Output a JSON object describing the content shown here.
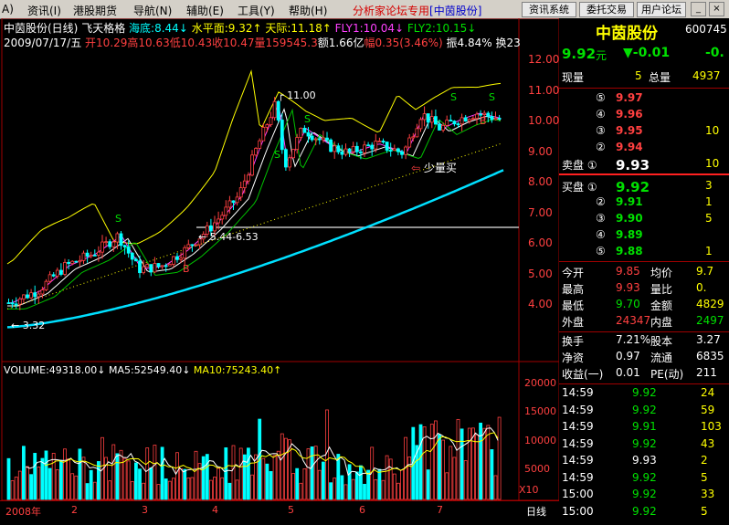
{
  "menu": {
    "items": [
      "A)",
      "资讯(I)",
      "港股期货",
      "导航(N)",
      "辅助(E)",
      "工具(Y)",
      "帮助(H)"
    ],
    "forum_title": "分析家论坛专用",
    "stock_tag": "[中茵股份]",
    "buttons": [
      "资讯系统",
      "委托交易",
      "用户论坛"
    ],
    "window_controls": [
      "_",
      "□",
      "×"
    ]
  },
  "chart_header": {
    "line1": {
      "name": "中茵股份(日线)",
      "indicator": "飞天格格",
      "haidi": "海底:8.44↓",
      "shuiping": "水平面:9.32↑",
      "tianji": "天际:11.18↑",
      "fly1": "FLY1:10.04↓",
      "fly2": "FLY2:10.15↓"
    },
    "line2": {
      "date": "2009/07/17/五",
      "open": "开10.29",
      "high": "高10.63",
      "low": "低10.43",
      "close": "收10.47",
      "volume": "量159545.3",
      "amount": "额1.66亿",
      "change": "幅0.35(3.46%)",
      "amplitude": "振4.84%",
      "turnover": "换23"
    }
  },
  "price_axis": [
    "12.00",
    "11.00",
    "10.00",
    "9.00",
    "8.00",
    "7.00",
    "6.00",
    "5.00",
    "4.00"
  ],
  "volume_axis": [
    "20000",
    "15000",
    "10000",
    "5000",
    "X10"
  ],
  "annotations": {
    "high_label": "11.00",
    "low_label": "3.32",
    "range_label": "5.44-6.53",
    "buy_text": "少量买",
    "s_marks": [
      "S",
      "S",
      "S",
      "S",
      "S"
    ],
    "b_marks": [
      "B",
      "B"
    ]
  },
  "volume_header": {
    "volume": "VOLUME:49318.00↓",
    "ma5": "MA5:52549.40↓",
    "ma10": "MA10:75243.40↑"
  },
  "date_axis": [
    "2008年",
    "2",
    "3",
    "4",
    "5",
    "6",
    "7"
  ],
  "period_label": "日线",
  "colors": {
    "up": "#ff4040",
    "down": "#00ffff",
    "ma_slow": "#00e0ff",
    "ma_yellow": "#ffff00",
    "ma_white": "#ffffff",
    "purple": "#ff40ff"
  },
  "quote": {
    "stock_name": "中茵股份",
    "code": "600745",
    "price": "9.92",
    "unit": "元",
    "change": "▼-0.01",
    "change_pct": "-0.",
    "xianliang_label": "现量",
    "xianliang_value": "5",
    "zongliang_label": "总量",
    "zongliang_value": "4937",
    "sell": [
      {
        "label": "⑤",
        "price": "9.97",
        "vol": ""
      },
      {
        "label": "④",
        "price": "9.96",
        "vol": ""
      },
      {
        "label": "③",
        "price": "9.95",
        "vol": "10"
      },
      {
        "label": "②",
        "price": "9.94",
        "vol": ""
      },
      {
        "label": "卖盘 ①",
        "price": "9.93",
        "vol": "10"
      }
    ],
    "buy": [
      {
        "label": "买盘 ①",
        "price": "9.92",
        "vol": "3"
      },
      {
        "label": "②",
        "price": "9.91",
        "vol": "1"
      },
      {
        "label": "③",
        "price": "9.90",
        "vol": "5"
      },
      {
        "label": "④",
        "price": "9.89",
        "vol": ""
      },
      {
        "label": "⑤",
        "price": "9.88",
        "vol": "1"
      }
    ],
    "stats": [
      {
        "l1": "今开",
        "v1": "9.85",
        "l2": "均价",
        "v2": "9.7"
      },
      {
        "l1": "最高",
        "v1": "9.93",
        "l2": "量比",
        "v2": "0."
      },
      {
        "l1": "最低",
        "v1": "9.70",
        "l2": "金额",
        "v2": "4829"
      },
      {
        "l1": "外盘",
        "v1": "24347",
        "l2": "内盘",
        "v2": "2497"
      }
    ],
    "fund": [
      {
        "l1": "换手",
        "v1": "7.21%",
        "l2": "股本",
        "v2": "3.27"
      },
      {
        "l1": "净资",
        "v1": "0.97",
        "l2": "流通",
        "v2": "6835"
      },
      {
        "l1": "收益(一)",
        "v1": "0.01",
        "l2": "PE(动)",
        "v2": "211"
      }
    ],
    "ticks": [
      {
        "time": "14:59",
        "price": "9.92",
        "vol": "24"
      },
      {
        "time": "14:59",
        "price": "9.92",
        "vol": "59"
      },
      {
        "time": "14:59",
        "price": "9.91",
        "vol": "103"
      },
      {
        "time": "14:59",
        "price": "9.92",
        "vol": "43"
      },
      {
        "time": "14:59",
        "price": "9.93",
        "vol": "2"
      },
      {
        "time": "14:59",
        "price": "9.92",
        "vol": "5"
      },
      {
        "time": "15:00",
        "price": "9.92",
        "vol": "33"
      },
      {
        "time": "15:00",
        "price": "9.92",
        "vol": "5"
      }
    ]
  }
}
